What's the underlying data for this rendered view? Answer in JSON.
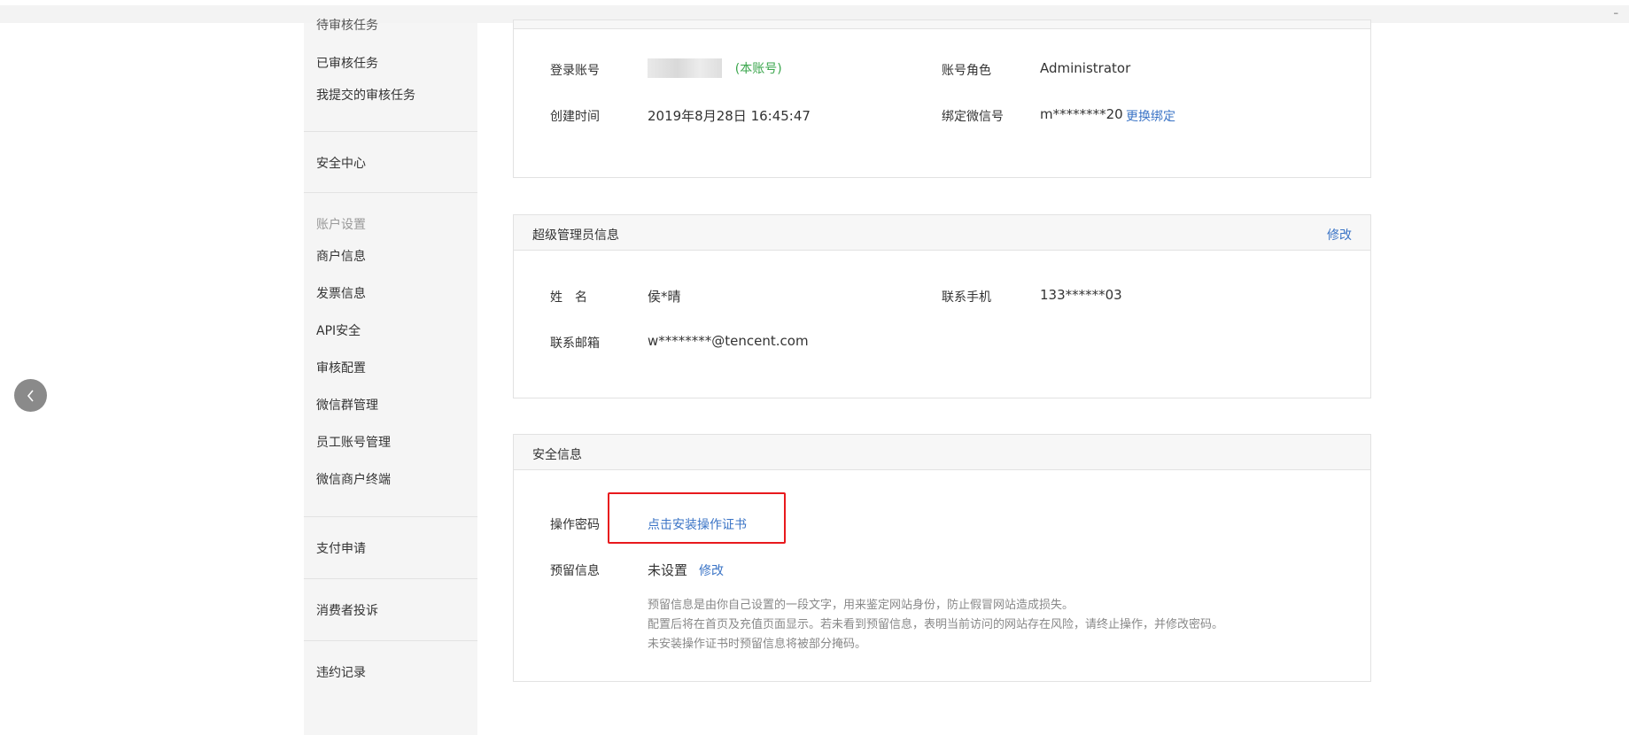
{
  "topbar": {
    "dash": "–"
  },
  "sidebar": {
    "items": [
      "待审核任务",
      "已审核任务",
      "我提交的审核任务",
      "安全中心",
      "账户设置",
      "商户信息",
      "发票信息",
      "API安全",
      "审核配置",
      "微信群管理",
      "员工账号管理",
      "微信商户终端",
      "支付申请",
      "消费者投诉",
      "违约记录"
    ]
  },
  "account": {
    "login_label": "登录账号",
    "login_tag": "(本账号)",
    "role_label": "账号角色",
    "role_value": "Administrator",
    "created_label": "创建时间",
    "created_value": "2019年8月28日 16:45:47",
    "wechat_label": "绑定微信号",
    "wechat_value": "m********20",
    "wechat_action": "更换绑定"
  },
  "admin": {
    "title": "超级管理员信息",
    "edit": "修改",
    "name_label": "姓　名",
    "name_value": "侯*晴",
    "phone_label": "联系手机",
    "phone_value": "133******03",
    "email_label": "联系邮箱",
    "email_value": "w********@tencent.com"
  },
  "security": {
    "title": "安全信息",
    "password_label": "操作密码",
    "password_action": "点击安装操作证书",
    "reserved_label": "预留信息",
    "reserved_value": "未设置",
    "reserved_edit": "修改",
    "hints": [
      "预留信息是由你自己设置的一段文字，用来鉴定网站身份，防止假冒网站造成损失。",
      "配置后将在首页及充值页面显示。若未看到预留信息，表明当前访问的网站存在风险，请终止操作，并修改密码。",
      "未安装操作证书时预留信息将被部分掩码。"
    ]
  }
}
